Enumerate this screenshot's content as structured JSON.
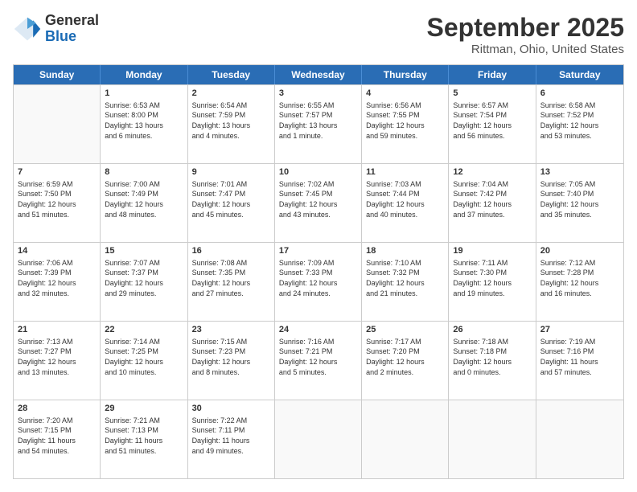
{
  "header": {
    "logo_general": "General",
    "logo_blue": "Blue",
    "main_title": "September 2025",
    "subtitle": "Rittman, Ohio, United States"
  },
  "days": [
    "Sunday",
    "Monday",
    "Tuesday",
    "Wednesday",
    "Thursday",
    "Friday",
    "Saturday"
  ],
  "weeks": [
    [
      {
        "day": "",
        "lines": []
      },
      {
        "day": "1",
        "lines": [
          "Sunrise: 6:53 AM",
          "Sunset: 8:00 PM",
          "Daylight: 13 hours",
          "and 6 minutes."
        ]
      },
      {
        "day": "2",
        "lines": [
          "Sunrise: 6:54 AM",
          "Sunset: 7:59 PM",
          "Daylight: 13 hours",
          "and 4 minutes."
        ]
      },
      {
        "day": "3",
        "lines": [
          "Sunrise: 6:55 AM",
          "Sunset: 7:57 PM",
          "Daylight: 13 hours",
          "and 1 minute."
        ]
      },
      {
        "day": "4",
        "lines": [
          "Sunrise: 6:56 AM",
          "Sunset: 7:55 PM",
          "Daylight: 12 hours",
          "and 59 minutes."
        ]
      },
      {
        "day": "5",
        "lines": [
          "Sunrise: 6:57 AM",
          "Sunset: 7:54 PM",
          "Daylight: 12 hours",
          "and 56 minutes."
        ]
      },
      {
        "day": "6",
        "lines": [
          "Sunrise: 6:58 AM",
          "Sunset: 7:52 PM",
          "Daylight: 12 hours",
          "and 53 minutes."
        ]
      }
    ],
    [
      {
        "day": "7",
        "lines": [
          "Sunrise: 6:59 AM",
          "Sunset: 7:50 PM",
          "Daylight: 12 hours",
          "and 51 minutes."
        ]
      },
      {
        "day": "8",
        "lines": [
          "Sunrise: 7:00 AM",
          "Sunset: 7:49 PM",
          "Daylight: 12 hours",
          "and 48 minutes."
        ]
      },
      {
        "day": "9",
        "lines": [
          "Sunrise: 7:01 AM",
          "Sunset: 7:47 PM",
          "Daylight: 12 hours",
          "and 45 minutes."
        ]
      },
      {
        "day": "10",
        "lines": [
          "Sunrise: 7:02 AM",
          "Sunset: 7:45 PM",
          "Daylight: 12 hours",
          "and 43 minutes."
        ]
      },
      {
        "day": "11",
        "lines": [
          "Sunrise: 7:03 AM",
          "Sunset: 7:44 PM",
          "Daylight: 12 hours",
          "and 40 minutes."
        ]
      },
      {
        "day": "12",
        "lines": [
          "Sunrise: 7:04 AM",
          "Sunset: 7:42 PM",
          "Daylight: 12 hours",
          "and 37 minutes."
        ]
      },
      {
        "day": "13",
        "lines": [
          "Sunrise: 7:05 AM",
          "Sunset: 7:40 PM",
          "Daylight: 12 hours",
          "and 35 minutes."
        ]
      }
    ],
    [
      {
        "day": "14",
        "lines": [
          "Sunrise: 7:06 AM",
          "Sunset: 7:39 PM",
          "Daylight: 12 hours",
          "and 32 minutes."
        ]
      },
      {
        "day": "15",
        "lines": [
          "Sunrise: 7:07 AM",
          "Sunset: 7:37 PM",
          "Daylight: 12 hours",
          "and 29 minutes."
        ]
      },
      {
        "day": "16",
        "lines": [
          "Sunrise: 7:08 AM",
          "Sunset: 7:35 PM",
          "Daylight: 12 hours",
          "and 27 minutes."
        ]
      },
      {
        "day": "17",
        "lines": [
          "Sunrise: 7:09 AM",
          "Sunset: 7:33 PM",
          "Daylight: 12 hours",
          "and 24 minutes."
        ]
      },
      {
        "day": "18",
        "lines": [
          "Sunrise: 7:10 AM",
          "Sunset: 7:32 PM",
          "Daylight: 12 hours",
          "and 21 minutes."
        ]
      },
      {
        "day": "19",
        "lines": [
          "Sunrise: 7:11 AM",
          "Sunset: 7:30 PM",
          "Daylight: 12 hours",
          "and 19 minutes."
        ]
      },
      {
        "day": "20",
        "lines": [
          "Sunrise: 7:12 AM",
          "Sunset: 7:28 PM",
          "Daylight: 12 hours",
          "and 16 minutes."
        ]
      }
    ],
    [
      {
        "day": "21",
        "lines": [
          "Sunrise: 7:13 AM",
          "Sunset: 7:27 PM",
          "Daylight: 12 hours",
          "and 13 minutes."
        ]
      },
      {
        "day": "22",
        "lines": [
          "Sunrise: 7:14 AM",
          "Sunset: 7:25 PM",
          "Daylight: 12 hours",
          "and 10 minutes."
        ]
      },
      {
        "day": "23",
        "lines": [
          "Sunrise: 7:15 AM",
          "Sunset: 7:23 PM",
          "Daylight: 12 hours",
          "and 8 minutes."
        ]
      },
      {
        "day": "24",
        "lines": [
          "Sunrise: 7:16 AM",
          "Sunset: 7:21 PM",
          "Daylight: 12 hours",
          "and 5 minutes."
        ]
      },
      {
        "day": "25",
        "lines": [
          "Sunrise: 7:17 AM",
          "Sunset: 7:20 PM",
          "Daylight: 12 hours",
          "and 2 minutes."
        ]
      },
      {
        "day": "26",
        "lines": [
          "Sunrise: 7:18 AM",
          "Sunset: 7:18 PM",
          "Daylight: 12 hours",
          "and 0 minutes."
        ]
      },
      {
        "day": "27",
        "lines": [
          "Sunrise: 7:19 AM",
          "Sunset: 7:16 PM",
          "Daylight: 11 hours",
          "and 57 minutes."
        ]
      }
    ],
    [
      {
        "day": "28",
        "lines": [
          "Sunrise: 7:20 AM",
          "Sunset: 7:15 PM",
          "Daylight: 11 hours",
          "and 54 minutes."
        ]
      },
      {
        "day": "29",
        "lines": [
          "Sunrise: 7:21 AM",
          "Sunset: 7:13 PM",
          "Daylight: 11 hours",
          "and 51 minutes."
        ]
      },
      {
        "day": "30",
        "lines": [
          "Sunrise: 7:22 AM",
          "Sunset: 7:11 PM",
          "Daylight: 11 hours",
          "and 49 minutes."
        ]
      },
      {
        "day": "",
        "lines": []
      },
      {
        "day": "",
        "lines": []
      },
      {
        "day": "",
        "lines": []
      },
      {
        "day": "",
        "lines": []
      }
    ]
  ]
}
